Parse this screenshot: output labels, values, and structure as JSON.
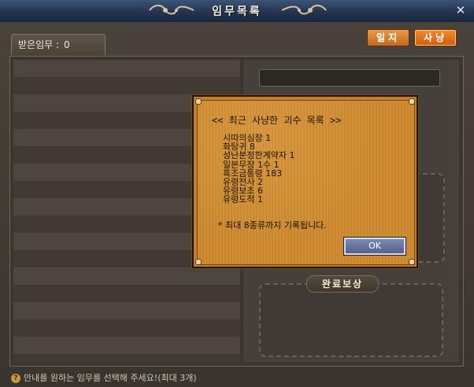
{
  "window": {
    "title": "임무목록",
    "close_symbol": "✕"
  },
  "top_buttons": {
    "journal_label": "일지",
    "hunt_label": "사냥"
  },
  "accepted_tab": {
    "label": "받은임무 :",
    "count": "0"
  },
  "reward_section": {
    "label": "완료보상"
  },
  "bottom_hint": {
    "icon": "hint-icon",
    "text": "안내를 원하는 임무를 선택해 주세요!(최대 3개)"
  },
  "dialog": {
    "title": "<< 최근 사냥한 괴수 목록 >>",
    "entries": [
      "시따의심장 1",
      "화탕귀 8",
      "성난분정한계약자 1",
      "일본무장 1수 1",
      "흑조금통령 183",
      "유령전사 2",
      "유령보초 6",
      "유령도적 1"
    ],
    "note": "* 최대 8종류까지 기록됩니다.",
    "ok_label": "OK"
  },
  "colors": {
    "titlebar": "#24344f",
    "dialog_bg": "#cd8a2e",
    "hunt_button": "#f28a30",
    "ok_button": "#55628a"
  }
}
